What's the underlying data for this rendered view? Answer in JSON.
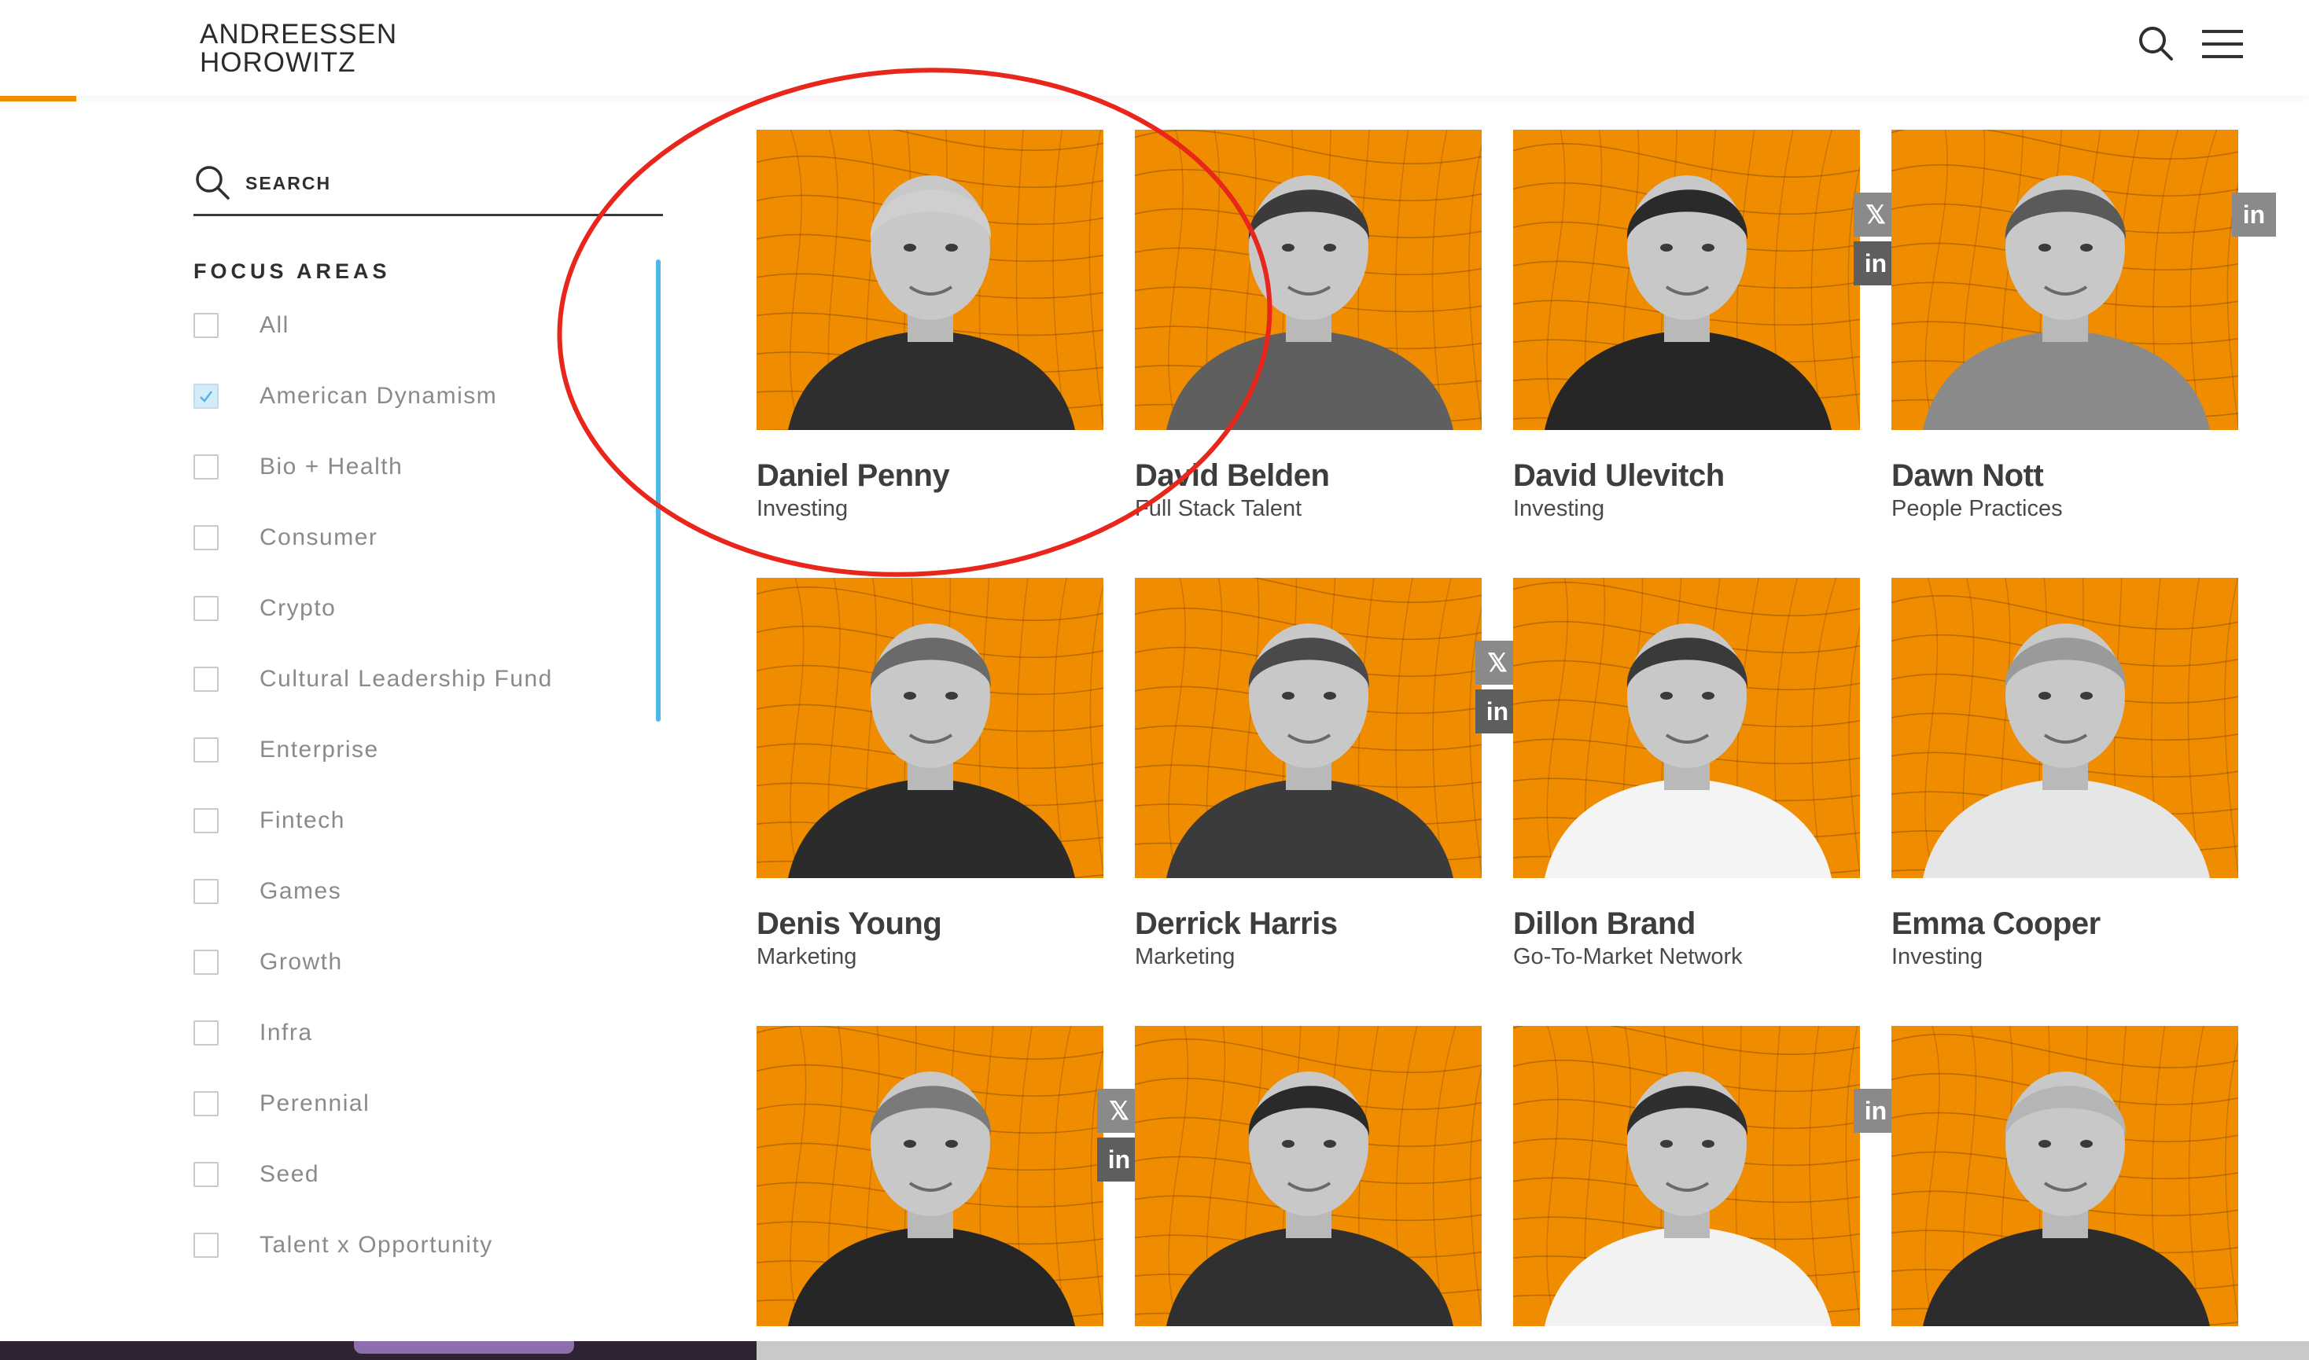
{
  "header": {
    "logo_line1": "ANDREESSEN",
    "logo_line2": "HOROWITZ",
    "search_icon": "search-icon",
    "menu_icon": "hamburger-menu-icon",
    "accent_color": "#f08c00"
  },
  "sidebar": {
    "search_placeholder": "SEARCH",
    "focus_areas_heading": "FOCUS AREAS",
    "filters": [
      {
        "label": "All",
        "checked": false
      },
      {
        "label": "American Dynamism",
        "checked": true
      },
      {
        "label": "Bio + Health",
        "checked": false
      },
      {
        "label": "Consumer",
        "checked": false
      },
      {
        "label": "Crypto",
        "checked": false
      },
      {
        "label": "Cultural Leadership Fund",
        "checked": false
      },
      {
        "label": "Enterprise",
        "checked": false
      },
      {
        "label": "Fintech",
        "checked": false
      },
      {
        "label": "Games",
        "checked": false
      },
      {
        "label": "Growth",
        "checked": false
      },
      {
        "label": "Infra",
        "checked": false
      },
      {
        "label": "Perennial",
        "checked": false
      },
      {
        "label": "Seed",
        "checked": false
      },
      {
        "label": "Talent x Opportunity",
        "checked": false
      }
    ]
  },
  "team": [
    {
      "name": "Daniel Penny",
      "role": "Investing",
      "social": []
    },
    {
      "name": "David Belden",
      "role": "Full Stack Talent",
      "social": []
    },
    {
      "name": "David Ulevitch",
      "role": "Investing",
      "social": [
        "x",
        "linkedin"
      ]
    },
    {
      "name": "Dawn Nott",
      "role": "People Practices",
      "social": [
        "linkedin"
      ]
    },
    {
      "name": "Denis Young",
      "role": "Marketing",
      "social": []
    },
    {
      "name": "Derrick Harris",
      "role": "Marketing",
      "social": [
        "x",
        "linkedin"
      ]
    },
    {
      "name": "Dillon Brand",
      "role": "Go-To-Market Network",
      "social": []
    },
    {
      "name": "Emma Cooper",
      "role": "Investing",
      "social": []
    },
    {
      "name": "",
      "role": "",
      "social": [
        "x",
        "linkedin"
      ]
    },
    {
      "name": "",
      "role": "",
      "social": []
    },
    {
      "name": "",
      "role": "",
      "social": [
        "linkedin"
      ]
    },
    {
      "name": "",
      "role": "",
      "social": []
    }
  ],
  "social_glyphs": {
    "x": "𝕏",
    "linkedin": "in"
  },
  "annotation": {
    "shape": "ellipse",
    "color": "#e8261c",
    "target": "Daniel Penny"
  }
}
